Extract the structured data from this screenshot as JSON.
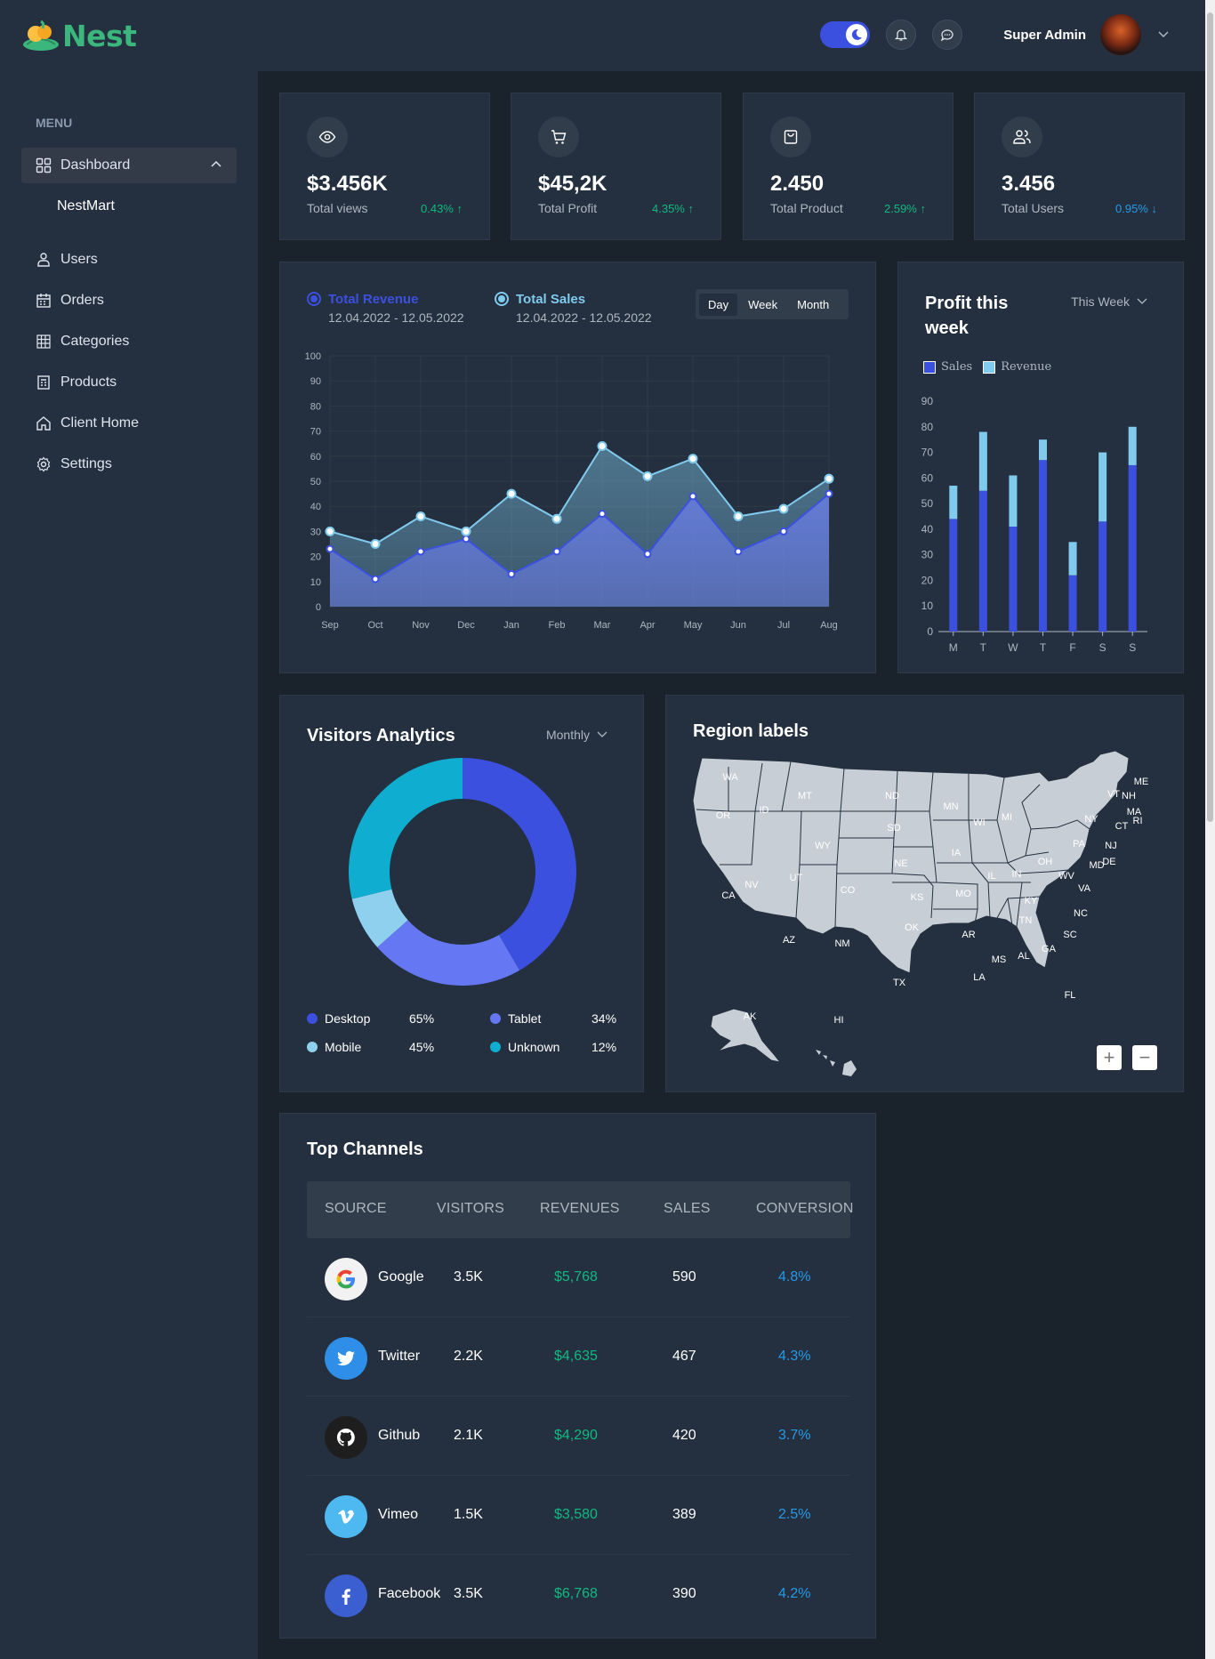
{
  "header": {
    "logo_text": "Nest",
    "user_name": "Super Admin"
  },
  "sidebar": {
    "menu_title": "MENU",
    "items": [
      {
        "label": "Dashboard",
        "icon": "grid-icon"
      },
      {
        "label": "Users",
        "icon": "user-icon"
      },
      {
        "label": "Orders",
        "icon": "calendar-icon"
      },
      {
        "label": "Categories",
        "icon": "category-grid-icon"
      },
      {
        "label": "Products",
        "icon": "product-icon"
      },
      {
        "label": "Client Home",
        "icon": "home-icon"
      },
      {
        "label": "Settings",
        "icon": "gear-icon"
      }
    ],
    "sub_item": "NestMart"
  },
  "stats": [
    {
      "value": "$3.456K",
      "label": "Total views",
      "change": "0.43%",
      "direction": "up",
      "icon": "eye-icon"
    },
    {
      "value": "$45,2K",
      "label": "Total Profit",
      "change": "4.35%",
      "direction": "up",
      "icon": "cart-icon"
    },
    {
      "value": "2.450",
      "label": "Total Product",
      "change": "2.59%",
      "direction": "up",
      "icon": "bag-icon"
    },
    {
      "value": "3.456",
      "label": "Total Users",
      "change": "0.95%",
      "direction": "down",
      "icon": "users-icon"
    }
  ],
  "revenue_chart": {
    "legend": [
      {
        "title": "Total Revenue",
        "dates": "12.04.2022 - 12.05.2022",
        "color": "#3c50e0"
      },
      {
        "title": "Total Sales",
        "dates": "12.04.2022 - 12.05.2022",
        "color": "#80caee"
      }
    ],
    "tabs": [
      "Day",
      "Week",
      "Month"
    ],
    "active_tab": "Day"
  },
  "profit_chart": {
    "title": "Profit this week",
    "dropdown": "This Week",
    "legend": [
      "Sales",
      "Revenue"
    ]
  },
  "visitors": {
    "title": "Visitors Analytics",
    "dropdown": "Monthly",
    "legend": [
      {
        "label": "Desktop",
        "value": "65%",
        "color": "#3c50e0"
      },
      {
        "label": "Tablet",
        "value": "34%",
        "color": "#6577f3"
      },
      {
        "label": "Mobile",
        "value": "45%",
        "color": "#8fd0ef"
      },
      {
        "label": "Unknown",
        "value": "12%",
        "color": "#0fadcf"
      }
    ]
  },
  "region": {
    "title": "Region labels",
    "zoom_in": "+",
    "zoom_out": "−",
    "state_labels": [
      "WA",
      "OR",
      "ID",
      "MT",
      "ND",
      "MN",
      "WI",
      "MI",
      "NY",
      "ME",
      "VT",
      "NH",
      "MA",
      "RI",
      "CT",
      "NJ",
      "DE",
      "MD",
      "PA",
      "OH",
      "IN",
      "IL",
      "IA",
      "SD",
      "WY",
      "NE",
      "UT",
      "NV",
      "CA",
      "CO",
      "KS",
      "MO",
      "KY",
      "WV",
      "VA",
      "NC",
      "TN",
      "SC",
      "GA",
      "AL",
      "MS",
      "AR",
      "OK",
      "AZ",
      "NM",
      "TX",
      "LA",
      "FL",
      "AK",
      "HI"
    ]
  },
  "channels": {
    "title": "Top Channels",
    "columns": [
      "SOURCE",
      "VISITORS",
      "REVENUES",
      "SALES",
      "CONVERSION"
    ],
    "rows": [
      {
        "source": "Google",
        "visitors": "3.5K",
        "revenues": "$5,768",
        "sales": "590",
        "conversion": "4.8%",
        "icon": "google-icon"
      },
      {
        "source": "Twitter",
        "visitors": "2.2K",
        "revenues": "$4,635",
        "sales": "467",
        "conversion": "4.3%",
        "icon": "twitter-icon"
      },
      {
        "source": "Github",
        "visitors": "2.1K",
        "revenues": "$4,290",
        "sales": "420",
        "conversion": "3.7%",
        "icon": "github-icon"
      },
      {
        "source": "Vimeo",
        "visitors": "1.5K",
        "revenues": "$3,580",
        "sales": "389",
        "conversion": "2.5%",
        "icon": "vimeo-icon"
      },
      {
        "source": "Facebook",
        "visitors": "3.5K",
        "revenues": "$6,768",
        "sales": "390",
        "conversion": "4.2%",
        "icon": "facebook-icon"
      }
    ]
  },
  "chart_data": [
    {
      "type": "area",
      "categories": [
        "Sep",
        "Oct",
        "Nov",
        "Dec",
        "Jan",
        "Feb",
        "Mar",
        "Apr",
        "May",
        "Jun",
        "Jul",
        "Aug"
      ],
      "series": [
        {
          "name": "Total Revenue",
          "values": [
            23,
            11,
            22,
            27,
            13,
            22,
            37,
            21,
            44,
            22,
            30,
            45
          ]
        },
        {
          "name": "Total Sales",
          "values": [
            30,
            25,
            36,
            30,
            45,
            35,
            64,
            52,
            59,
            36,
            39,
            51
          ]
        }
      ],
      "ylim": [
        0,
        100
      ],
      "yticks": [
        0,
        10,
        20,
        30,
        40,
        50,
        60,
        70,
        80,
        90,
        100
      ],
      "grid": true
    },
    {
      "type": "bar",
      "stacked": true,
      "categories": [
        "M",
        "T",
        "W",
        "T",
        "F",
        "S",
        "S"
      ],
      "series": [
        {
          "name": "Sales",
          "values": [
            44,
            55,
            41,
            67,
            22,
            43,
            65
          ]
        },
        {
          "name": "Revenue",
          "values": [
            13,
            23,
            20,
            8,
            13,
            27,
            15
          ]
        }
      ],
      "ylim": [
        0,
        90
      ],
      "yticks": [
        0,
        10,
        20,
        30,
        40,
        50,
        60,
        70,
        80,
        90
      ]
    },
    {
      "type": "pie",
      "donut": true,
      "labels": [
        "Desktop",
        "Tablet",
        "Mobile",
        "Unknown"
      ],
      "values": [
        65,
        34,
        12,
        45
      ]
    }
  ]
}
